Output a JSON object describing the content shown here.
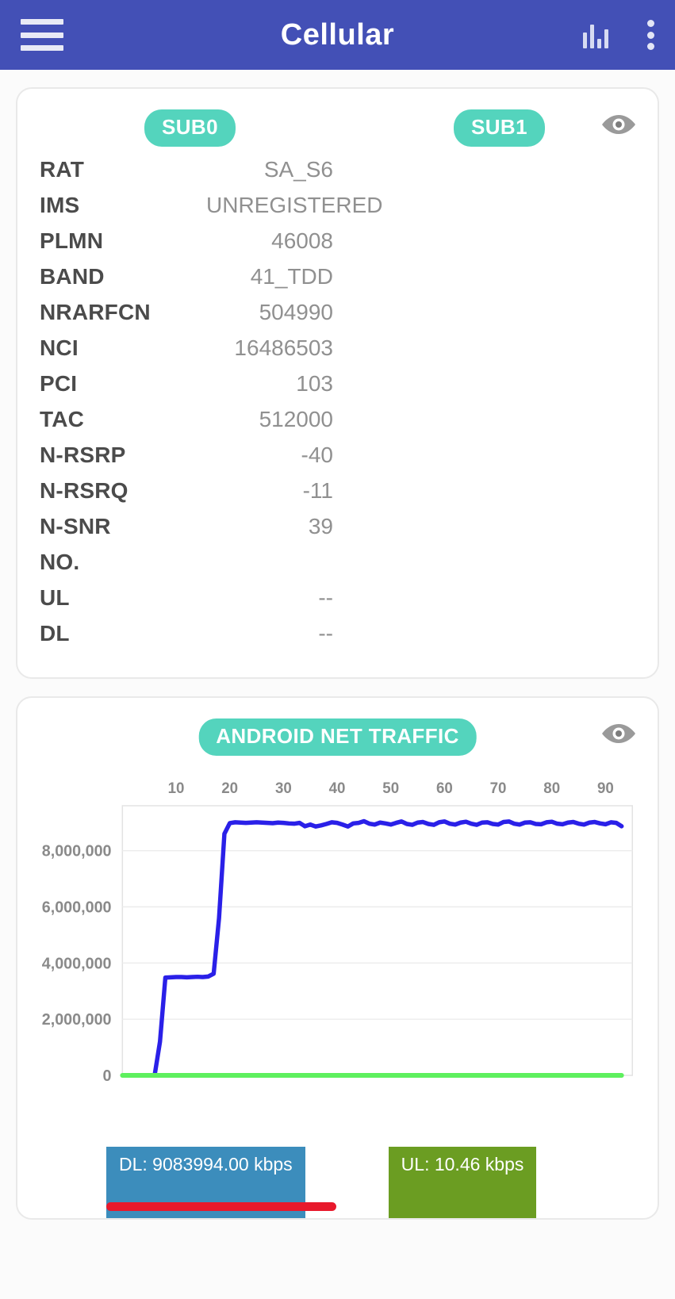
{
  "appbar": {
    "title": "Cellular",
    "menu_icon": "hamburger-menu-icon",
    "chart_icon": "bar-chart-icon",
    "overflow_icon": "kebab-menu-icon"
  },
  "sim_card": {
    "columns": [
      "SUB0",
      "SUB1"
    ],
    "visibility_icon": "eye-icon",
    "rows": [
      {
        "key": "RAT",
        "sub0": "SA_S6",
        "sub1": ""
      },
      {
        "key": "IMS",
        "sub0": "UNREGISTERED",
        "sub1": ""
      },
      {
        "key": "PLMN",
        "sub0": "46008",
        "sub1": ""
      },
      {
        "key": "BAND",
        "sub0": "41_TDD",
        "sub1": ""
      },
      {
        "key": "NRARFCN",
        "sub0": "504990",
        "sub1": ""
      },
      {
        "key": "NCI",
        "sub0": "16486503",
        "sub1": ""
      },
      {
        "key": "PCI",
        "sub0": "103",
        "sub1": ""
      },
      {
        "key": "TAC",
        "sub0": "512000",
        "sub1": ""
      },
      {
        "key": "N-RSRP",
        "sub0": "-40",
        "sub1": ""
      },
      {
        "key": "N-RSRQ",
        "sub0": "-11",
        "sub1": ""
      },
      {
        "key": "N-SNR",
        "sub0": "39",
        "sub1": ""
      },
      {
        "key": "NO.",
        "sub0": "",
        "sub1": ""
      },
      {
        "key": "UL",
        "sub0": "--",
        "sub1": ""
      },
      {
        "key": "DL",
        "sub0": "--",
        "sub1": ""
      }
    ]
  },
  "traffic_card": {
    "title": "ANDROID NET TRAFFIC",
    "visibility_icon": "eye-icon",
    "legend": {
      "dl_label": "DL: 9083994.00 kbps",
      "ul_label": "UL: 10.46 kbps",
      "dl_color": "#3c8dbc",
      "ul_color": "#6b9d22",
      "highlight_color": "#e8192c"
    }
  },
  "chart_data": {
    "type": "line",
    "title": "ANDROID NET TRAFFIC",
    "xlabel": "",
    "ylabel": "",
    "xlim": [
      0,
      95
    ],
    "ylim": [
      0,
      9600000
    ],
    "grid": true,
    "x_axis_position": "top",
    "legend_position": "bottom",
    "xticks": [
      10,
      20,
      30,
      40,
      50,
      60,
      70,
      80,
      90
    ],
    "yticks": [
      0,
      2000000,
      4000000,
      6000000,
      8000000
    ],
    "ytick_labels": [
      "0",
      "2,000,000",
      "4,000,000",
      "6,000,000",
      "8,000,000"
    ],
    "series": [
      {
        "name": "DL",
        "color": "#2a20e8",
        "x": [
          6,
          7,
          8,
          9,
          10,
          11,
          12,
          13,
          14,
          15,
          16,
          17,
          18,
          19,
          20,
          21,
          22,
          23,
          24,
          25,
          26,
          27,
          28,
          29,
          30,
          31,
          32,
          33,
          34,
          35,
          36,
          37,
          38,
          39,
          40,
          41,
          42,
          43,
          44,
          45,
          46,
          47,
          48,
          49,
          50,
          51,
          52,
          53,
          54,
          55,
          56,
          57,
          58,
          59,
          60,
          61,
          62,
          63,
          64,
          65,
          66,
          67,
          68,
          69,
          70,
          71,
          72,
          73,
          74,
          75,
          76,
          77,
          78,
          79,
          80,
          81,
          82,
          83,
          84,
          85,
          86,
          87,
          88,
          89,
          90,
          91,
          92,
          93
        ],
        "values": [
          0,
          1200000,
          3480000,
          3490000,
          3500000,
          3500000,
          3490000,
          3500000,
          3510000,
          3500000,
          3520000,
          3620000,
          5600000,
          8600000,
          8980000,
          9010000,
          9000000,
          8990000,
          9000000,
          9010000,
          9000000,
          8990000,
          8980000,
          9000000,
          8990000,
          8970000,
          8960000,
          8990000,
          8870000,
          8930000,
          8860000,
          8900000,
          8950000,
          9010000,
          8990000,
          8930000,
          8860000,
          8970000,
          8990000,
          9050000,
          8960000,
          8930000,
          9000000,
          8970000,
          8930000,
          8990000,
          9040000,
          8950000,
          8920000,
          9000000,
          9020000,
          8950000,
          8920000,
          9010000,
          9040000,
          8960000,
          8930000,
          9000000,
          9030000,
          8960000,
          8920000,
          9000000,
          9010000,
          8950000,
          8930000,
          9020000,
          9040000,
          8960000,
          8930000,
          9000000,
          9010000,
          8950000,
          8940000,
          9010000,
          9030000,
          8960000,
          8940000,
          9000000,
          9020000,
          8960000,
          8930000,
          9000000,
          9020000,
          8970000,
          8940000,
          9010000,
          8990000,
          8870000
        ]
      },
      {
        "name": "UL",
        "color": "#5ef05e",
        "x": [
          0,
          93
        ],
        "values": [
          0,
          0
        ]
      }
    ]
  }
}
